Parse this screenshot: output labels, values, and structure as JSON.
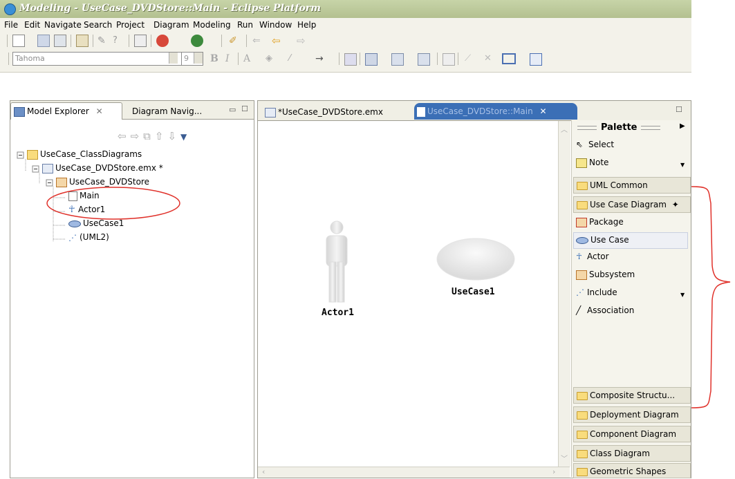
{
  "window": {
    "title": "Modeling - UseCase_DVDStore::Main - Eclipse Platform"
  },
  "menu": [
    "File",
    "Edit",
    "Navigate",
    "Search",
    "Project",
    "Diagram",
    "Modeling",
    "Run",
    "Window",
    "Help"
  ],
  "toolbar": {
    "font_name": "Tahoma",
    "font_size": "9"
  },
  "left_panel": {
    "tabs": [
      "Model Explorer",
      "Diagram Navig..."
    ],
    "tree": [
      {
        "label": "UseCase_ClassDiagrams"
      },
      {
        "label": "UseCase_DVDStore.emx *"
      },
      {
        "label": "UseCase_DVDStore"
      },
      {
        "label": "Main"
      },
      {
        "label": "Actor1"
      },
      {
        "label": "UseCase1"
      },
      {
        "label": "(UML2)"
      }
    ]
  },
  "editor": {
    "tabs": [
      "*UseCase_DVDStore.emx",
      "UseCase_DVDStore::Main"
    ],
    "actor_label": "Actor1",
    "usecase_label": "UseCase1"
  },
  "palette": {
    "title": "Palette",
    "tools": [
      "Select",
      "Note"
    ],
    "drawers_top": [
      "UML Common",
      "Use Case Diagram"
    ],
    "items": [
      "Package",
      "Use Case",
      "Actor",
      "Subsystem",
      "Include",
      "Association"
    ],
    "drawers_bottom": [
      "Composite Structu...",
      "Deployment Diagram",
      "Component Diagram",
      "Class Diagram",
      "Geometric Shapes"
    ]
  },
  "colors": {
    "highlight_ellipse": "#e0312a",
    "title_bar": "#b8c497",
    "selected_tab": "#3b6fb6"
  }
}
